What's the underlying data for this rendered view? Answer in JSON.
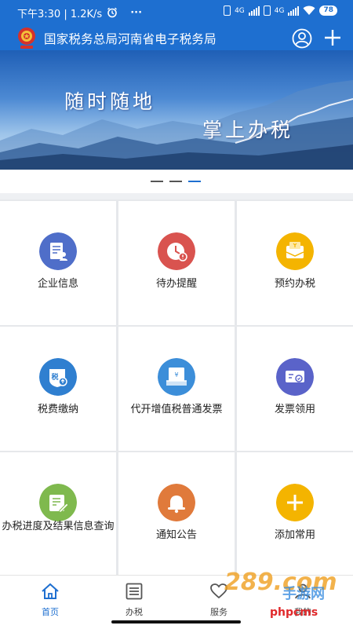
{
  "status": {
    "time_text": "下午3:30 | 1.2K/s",
    "more": "···",
    "battery": "78",
    "net": "4G"
  },
  "header": {
    "title": "国家税务总局河南省电子税务局"
  },
  "banner": {
    "slogan_line1": "随时随地",
    "slogan_line2": "掌上办税"
  },
  "carousel": {
    "count": 3,
    "active_index": 2
  },
  "grid": [
    {
      "label": "企业信息",
      "icon": "company-info-icon",
      "color": "#4f6ec9"
    },
    {
      "label": "待办提醒",
      "icon": "clock-reminder-icon",
      "color": "#d9534f"
    },
    {
      "label": "预约办税",
      "icon": "appointment-icon",
      "color": "#f4b400"
    },
    {
      "label": "税费缴纳",
      "icon": "tax-payment-icon",
      "color": "#2f7fd0"
    },
    {
      "label": "代开增值税普通发票",
      "icon": "invoice-issue-icon",
      "color": "#3c8ed9"
    },
    {
      "label": "发票领用",
      "icon": "invoice-receive-icon",
      "color": "#5a63c9"
    },
    {
      "label": "办税进度及结果信息查询",
      "icon": "progress-query-icon",
      "color": "#7fb94e"
    },
    {
      "label": "通知公告",
      "icon": "bell-icon",
      "color": "#e07a3b"
    },
    {
      "label": "添加常用",
      "icon": "add-icon",
      "color": "#f4b400"
    }
  ],
  "tabbar": [
    {
      "label": "首页",
      "icon": "home-icon",
      "active": true
    },
    {
      "label": "办税",
      "icon": "list-icon",
      "active": false
    },
    {
      "label": "服务",
      "icon": "service-icon",
      "active": false
    },
    {
      "label": "我的",
      "icon": "profile-icon",
      "active": false
    }
  ],
  "watermark": {
    "site": "289.com",
    "sub": "手游网",
    "brand": "phpcms"
  },
  "colors": {
    "primary": "#1e6fd0",
    "text": "#222222",
    "divider": "#e6e8eb"
  }
}
